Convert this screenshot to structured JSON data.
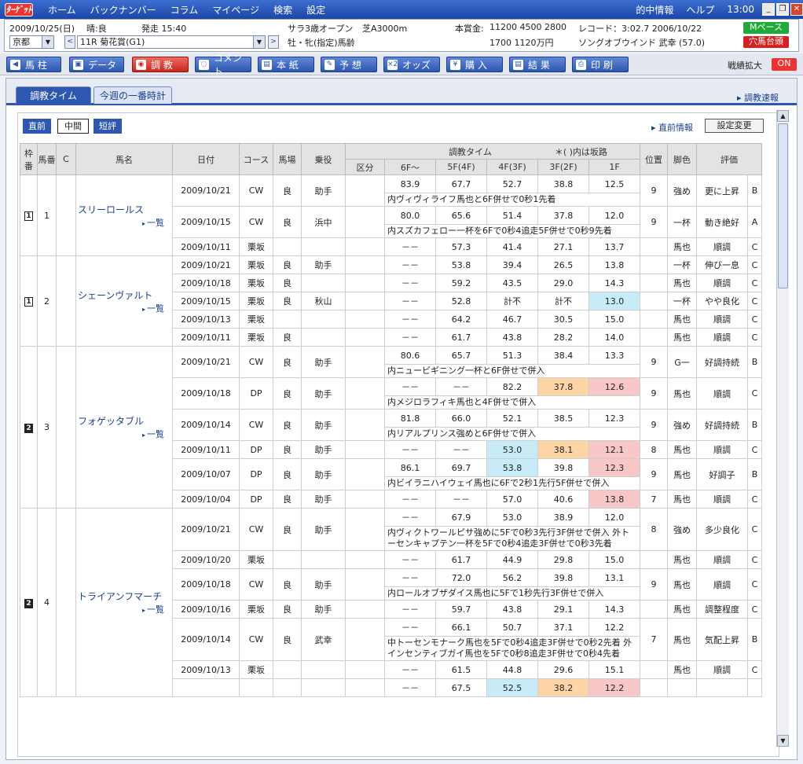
{
  "window": {
    "logo": "ﾀｰｹﾞｯﾄ",
    "menu": [
      "ホーム",
      "バックナンバー",
      "コラム",
      "マイページ",
      "検索",
      "設定"
    ],
    "right": [
      "的中情報",
      "ヘルプ",
      "13:00"
    ]
  },
  "info": {
    "date": "2009/10/25(日)",
    "weather": "晴:良",
    "start": "発走 15:40",
    "venue": "京都",
    "race": "11R 菊花賞(G1)",
    "class": "サラ3歳オープン",
    "track": "芝A3000m",
    "cond": "牡・牝(指定)馬齢",
    "prize_label": "本賞金:",
    "prize1": "11200 4500 2800",
    "prize2": "1700 1120万円",
    "record": "レコード：3:02.7 2006/10/22",
    "record2": "ソングオブウインド 武幸 (57.0)",
    "badge1": "Mペース",
    "badge2": "穴馬台頭"
  },
  "toolbar": {
    "buttons": [
      "馬 柱",
      "データ",
      "調 教",
      "コメント",
      "本 紙",
      "予 想",
      "オッズ",
      "購 入",
      "結 果",
      "印 刷"
    ],
    "icons": [
      "◀",
      "▣",
      "◉",
      "◌",
      "▤",
      "✎",
      "×2",
      "¥",
      "▤",
      "⎙"
    ],
    "right_label": "戦績拡大",
    "toggle": "ON"
  },
  "tabs": {
    "t1": "調教タイム",
    "t2": "今週の一番時計",
    "right": "調教速報"
  },
  "sub": {
    "s1": "直前",
    "s2": "中間",
    "s3": "短評",
    "link": "直前情報",
    "setting": "設定変更"
  },
  "head": {
    "waku": "枠番",
    "uma": "馬番",
    "c": "C",
    "name": "馬名",
    "date": "日付",
    "course": "コース",
    "baba": "馬場",
    "rider": "乗役",
    "times": "調教タイム",
    "note": "＊( )内は坂路",
    "kubun": "区分",
    "f6": "6F〜",
    "f5": "5F(4F)",
    "f4": "4F(3F)",
    "f3": "3F(2F)",
    "f1": "1F",
    "pos": "位置",
    "kyaku": "脚色",
    "eval": "評価"
  },
  "horses": [
    {
      "waku": "1",
      "num": "1",
      "name": "スリーロールス",
      "list": "一覧",
      "rows": [
        {
          "date": "2009/10/21",
          "course": "CW",
          "baba": "良",
          "rider": "助手",
          "t": [
            "83.9",
            "67.7",
            "52.7",
            "38.8",
            "12.5"
          ],
          "hl": [
            "",
            "",
            "",
            "",
            ""
          ],
          "pos": "9",
          "kyaku": "強め",
          "hyoka": "更に上昇",
          "rank": "B",
          "comment": "内ヴィヴィライフ馬也と6F併せで0秒1先着"
        },
        {
          "date": "2009/10/15",
          "course": "CW",
          "baba": "良",
          "rider": "浜中",
          "t": [
            "80.0",
            "65.6",
            "51.4",
            "37.8",
            "12.0"
          ],
          "hl": [
            "",
            "",
            "",
            "",
            ""
          ],
          "pos": "9",
          "kyaku": "一杯",
          "hyoka": "動き絶好",
          "rank": "A",
          "comment": "内スズカフェロー一杯を6Fで0秒4追走5F併せで0秒9先着"
        },
        {
          "date": "2009/10/11",
          "course": "栗坂",
          "baba": "",
          "rider": "",
          "t": [
            "－－",
            "57.3",
            "41.4",
            "27.1",
            "13.7"
          ],
          "hl": [
            "",
            "",
            "",
            "",
            ""
          ],
          "pos": "",
          "kyaku": "馬也",
          "hyoka": "順調",
          "rank": "C",
          "comment": ""
        }
      ]
    },
    {
      "waku": "1",
      "num": "2",
      "name": "シェーンヴァルト",
      "list": "一覧",
      "rows": [
        {
          "date": "2009/10/21",
          "course": "栗坂",
          "baba": "良",
          "rider": "助手",
          "t": [
            "－－",
            "53.8",
            "39.4",
            "26.5",
            "13.8"
          ],
          "hl": [
            "",
            "",
            "",
            "",
            ""
          ],
          "pos": "",
          "kyaku": "一杯",
          "hyoka": "伸び一息",
          "rank": "C",
          "comment": ""
        },
        {
          "date": "2009/10/18",
          "course": "栗坂",
          "baba": "良",
          "rider": "",
          "t": [
            "－－",
            "59.2",
            "43.5",
            "29.0",
            "14.3"
          ],
          "hl": [
            "",
            "",
            "",
            "",
            ""
          ],
          "pos": "",
          "kyaku": "馬也",
          "hyoka": "順調",
          "rank": "C",
          "comment": ""
        },
        {
          "date": "2009/10/15",
          "course": "栗坂",
          "baba": "良",
          "rider": "秋山",
          "t": [
            "－－",
            "52.8",
            "計不",
            "計不",
            "13.0"
          ],
          "hl": [
            "",
            "",
            "",
            "",
            "blue"
          ],
          "pos": "",
          "kyaku": "一杯",
          "hyoka": "やや良化",
          "rank": "C",
          "comment": ""
        },
        {
          "date": "2009/10/13",
          "course": "栗坂",
          "baba": "",
          "rider": "",
          "t": [
            "－－",
            "64.2",
            "46.7",
            "30.5",
            "15.0"
          ],
          "hl": [
            "",
            "",
            "",
            "",
            ""
          ],
          "pos": "",
          "kyaku": "馬也",
          "hyoka": "順調",
          "rank": "C",
          "comment": ""
        },
        {
          "date": "2009/10/11",
          "course": "栗坂",
          "baba": "良",
          "rider": "",
          "t": [
            "－－",
            "61.7",
            "43.8",
            "28.2",
            "14.0"
          ],
          "hl": [
            "",
            "",
            "",
            "",
            ""
          ],
          "pos": "",
          "kyaku": "馬也",
          "hyoka": "順調",
          "rank": "C",
          "comment": ""
        }
      ]
    },
    {
      "waku": "2",
      "num": "3",
      "name": "フォゲッタブル",
      "list": "一覧",
      "rows": [
        {
          "date": "2009/10/21",
          "course": "CW",
          "baba": "良",
          "rider": "助手",
          "t": [
            "80.6",
            "65.7",
            "51.3",
            "38.4",
            "13.3"
          ],
          "hl": [
            "",
            "",
            "",
            "",
            ""
          ],
          "pos": "9",
          "kyaku": "G一",
          "hyoka": "好調持続",
          "rank": "B",
          "comment": "内ニュービギニング一杯と6F併せで併入"
        },
        {
          "date": "2009/10/18",
          "course": "DP",
          "baba": "良",
          "rider": "助手",
          "t": [
            "－－",
            "－－",
            "82.2",
            "37.8",
            "12.6"
          ],
          "hl": [
            "",
            "",
            "",
            "ora",
            "pink"
          ],
          "pos": "9",
          "kyaku": "馬也",
          "hyoka": "順調",
          "rank": "C",
          "comment": "内メジロラフィキ馬也と4F併せで併入"
        },
        {
          "date": "2009/10/14",
          "course": "CW",
          "baba": "良",
          "rider": "助手",
          "t": [
            "81.8",
            "66.0",
            "52.1",
            "38.5",
            "12.3"
          ],
          "hl": [
            "",
            "",
            "",
            "",
            ""
          ],
          "pos": "9",
          "kyaku": "強め",
          "hyoka": "好調持続",
          "rank": "B",
          "comment": "内リアルプリンス強めと6F併せで併入"
        },
        {
          "date": "2009/10/11",
          "course": "DP",
          "baba": "良",
          "rider": "助手",
          "t": [
            "－－",
            "－－",
            "53.0",
            "38.1",
            "12.1"
          ],
          "hl": [
            "",
            "",
            "blue",
            "ora",
            "pink"
          ],
          "pos": "8",
          "kyaku": "馬也",
          "hyoka": "順調",
          "rank": "C",
          "comment": ""
        },
        {
          "date": "2009/10/07",
          "course": "DP",
          "baba": "良",
          "rider": "助手",
          "t": [
            "86.1",
            "69.7",
            "53.8",
            "39.8",
            "12.3"
          ],
          "hl": [
            "",
            "",
            "blue",
            "",
            "pink"
          ],
          "pos": "9",
          "kyaku": "馬也",
          "hyoka": "好調子",
          "rank": "B",
          "comment": "内ビイラニハイウェイ馬也に6Fで2秒1先行5F併せで併入"
        },
        {
          "date": "2009/10/04",
          "course": "DP",
          "baba": "良",
          "rider": "助手",
          "t": [
            "－－",
            "－－",
            "57.0",
            "40.6",
            "13.8"
          ],
          "hl": [
            "",
            "",
            "",
            "",
            "pink"
          ],
          "pos": "7",
          "kyaku": "馬也",
          "hyoka": "順調",
          "rank": "C",
          "comment": ""
        }
      ]
    },
    {
      "waku": "2",
      "num": "4",
      "name": "トライアンフマーチ",
      "list": "一覧",
      "rows": [
        {
          "date": "2009/10/21",
          "course": "CW",
          "baba": "良",
          "rider": "助手",
          "t": [
            "－－",
            "67.9",
            "53.0",
            "38.9",
            "12.0"
          ],
          "hl": [
            "",
            "",
            "",
            "",
            ""
          ],
          "pos": "8",
          "kyaku": "強め",
          "hyoka": "多少良化",
          "rank": "C",
          "comment": "内ヴィクトワールピサ強めに5Fで0秒3先行3F併せで併入 外トーセンキャプテン一杯を5Fで0秒4追走3F併せで0秒3先着"
        },
        {
          "date": "2009/10/20",
          "course": "栗坂",
          "baba": "",
          "rider": "",
          "t": [
            "－－",
            "61.7",
            "44.9",
            "29.8",
            "15.0"
          ],
          "hl": [
            "",
            "",
            "",
            "",
            ""
          ],
          "pos": "",
          "kyaku": "馬也",
          "hyoka": "順調",
          "rank": "C",
          "comment": ""
        },
        {
          "date": "2009/10/18",
          "course": "CW",
          "baba": "良",
          "rider": "助手",
          "t": [
            "－－",
            "72.0",
            "56.2",
            "39.8",
            "13.1"
          ],
          "hl": [
            "",
            "",
            "",
            "",
            ""
          ],
          "pos": "9",
          "kyaku": "馬也",
          "hyoka": "順調",
          "rank": "C",
          "comment": "内ロールオブザダイス馬也に5Fで1秒先行3F併せで併入"
        },
        {
          "date": "2009/10/16",
          "course": "栗坂",
          "baba": "良",
          "rider": "助手",
          "t": [
            "－－",
            "59.7",
            "43.8",
            "29.1",
            "14.3"
          ],
          "hl": [
            "",
            "",
            "",
            "",
            ""
          ],
          "pos": "",
          "kyaku": "馬也",
          "hyoka": "調整程度",
          "rank": "C",
          "comment": ""
        },
        {
          "date": "2009/10/14",
          "course": "CW",
          "baba": "良",
          "rider": "武幸",
          "t": [
            "－－",
            "66.1",
            "50.7",
            "37.1",
            "12.2"
          ],
          "hl": [
            "",
            "",
            "",
            "",
            ""
          ],
          "pos": "7",
          "kyaku": "馬也",
          "hyoka": "気配上昇",
          "rank": "B",
          "comment": "中トーセンモナーク馬也を5Fで0秒4追走3F併せで0秒2先着 外インセンティブガイ馬也を5Fで0秒8追走3F併せで0秒4先着"
        },
        {
          "date": "2009/10/13",
          "course": "栗坂",
          "baba": "",
          "rider": "",
          "t": [
            "－－",
            "61.5",
            "44.8",
            "29.6",
            "15.1"
          ],
          "hl": [
            "",
            "",
            "",
            "",
            ""
          ],
          "pos": "",
          "kyaku": "馬也",
          "hyoka": "順調",
          "rank": "C",
          "comment": ""
        },
        {
          "date": "",
          "course": "",
          "baba": "",
          "rider": "",
          "t": [
            "－－",
            "67.5",
            "52.5",
            "38.2",
            "12.2"
          ],
          "hl": [
            "",
            "",
            "blue",
            "ora",
            "pink"
          ],
          "pos": "",
          "kyaku": "",
          "hyoka": "",
          "rank": "",
          "comment": ""
        }
      ]
    }
  ]
}
